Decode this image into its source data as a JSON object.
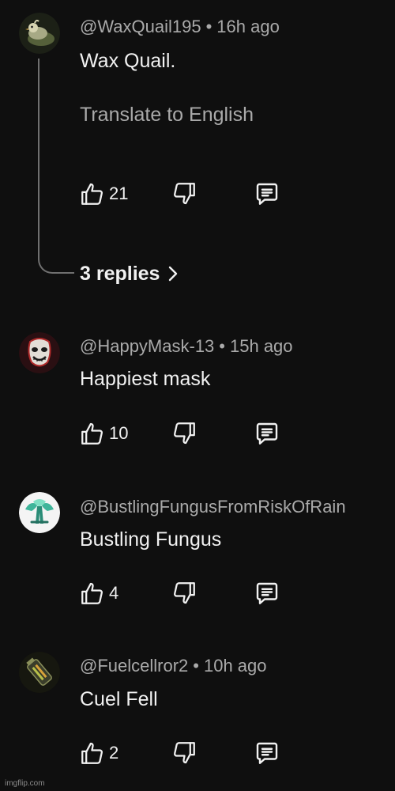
{
  "comments": [
    {
      "author": "@WaxQuail195",
      "time": "16h ago",
      "text": "Wax Quail.",
      "translate_label": "Translate to English",
      "likes": "21",
      "avatar_icon": "quail-avatar-icon"
    },
    {
      "author": "@HappyMask-13",
      "time": "15h ago",
      "text": "Happiest mask",
      "likes": "10",
      "avatar_icon": "mask-avatar-icon"
    },
    {
      "author": "@BustlingFungusFromRiskOfRain",
      "time": "",
      "text": "Bustling Fungus",
      "likes": "4",
      "avatar_icon": "fungus-avatar-icon"
    },
    {
      "author": "@Fuelcellror2",
      "time": "10h ago",
      "text": "Cuel Fell",
      "likes": "2",
      "avatar_icon": "fuel-cell-avatar-icon"
    }
  ],
  "replies_label": "3 replies",
  "separator": "•",
  "watermark": "imgflip.com",
  "colors": {
    "background": "#0f0f0f",
    "primary_text": "#f1f1f1",
    "secondary_text": "#aaaaaa",
    "thread_line": "#6f6f6f"
  }
}
